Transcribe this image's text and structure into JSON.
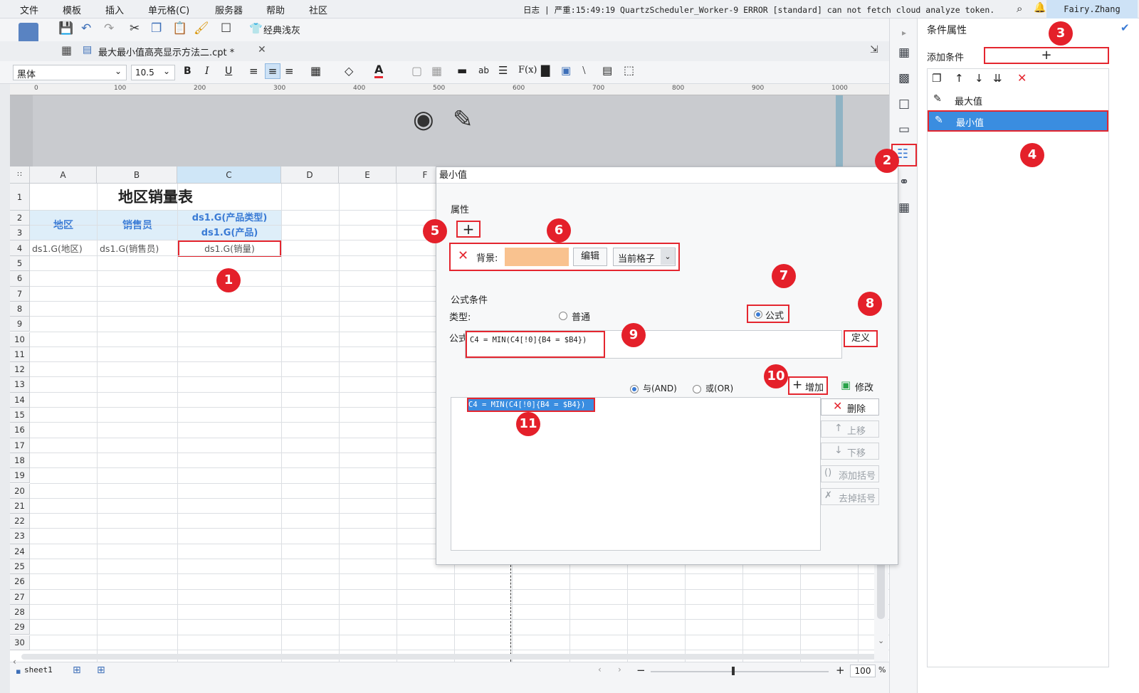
{
  "menu": {
    "items": [
      "文件",
      "模板",
      "插入",
      "单元格(C)",
      "服务器",
      "帮助",
      "社区"
    ]
  },
  "log": {
    "text": "日志 | 严重:15:49:19 QuartzScheduler_Worker-9 ERROR [standard] can not fetch cloud analyze token."
  },
  "user": {
    "name": "Fairy.Zhang"
  },
  "toolbar": {
    "theme_label": "经典浅灰"
  },
  "tab": {
    "title": "最大最小值高亮显示方法二.cpt *"
  },
  "format": {
    "font_family": "黑体",
    "font_size": "10.5"
  },
  "ruler": {
    "ticks": [
      "0",
      "100",
      "200",
      "300",
      "400",
      "500",
      "600",
      "700",
      "800",
      "900",
      "1000"
    ]
  },
  "sheet": {
    "columns": [
      "A",
      "B",
      "C",
      "D",
      "E",
      "F"
    ],
    "rows": [
      "1",
      "2",
      "3",
      "4",
      "5",
      "6",
      "7",
      "8",
      "9",
      "10",
      "11",
      "12",
      "13",
      "14",
      "15",
      "16",
      "17",
      "18",
      "19",
      "20",
      "21",
      "22",
      "23",
      "24",
      "25",
      "26",
      "27",
      "28",
      "29",
      "30"
    ],
    "title": "地区销量表",
    "header_region": "地区",
    "header_seller": "销售员",
    "header_type": "ds1.G(产品类型)",
    "header_product": "ds1.G(产品)",
    "cell_a4": "ds1.G(地区)",
    "cell_b4": "ds1.G(销售员)",
    "cell_c4": "ds1.G(销量)",
    "sheet_tab": "sheet1"
  },
  "zoom": {
    "value": "100",
    "unit": "%"
  },
  "dialog": {
    "title": "最小值",
    "section_attr": "属性",
    "attr_label": "背景:",
    "attr_color": "#f9c28f",
    "edit_button": "编辑",
    "scope_select": "当前格子",
    "section_formula": "公式条件",
    "type_label": "类型:",
    "radio_normal": "普通",
    "radio_formula": "公式",
    "formula_label": "公式=",
    "formula_value": "C4 = MIN(C4[!0]{B4 = $B4})",
    "define_button": "定义",
    "and_label": "与(AND)",
    "or_label": "或(OR)",
    "add_button": "增加",
    "modify_button": "修改",
    "delete_button": "删除",
    "up_button": "上移",
    "down_button": "下移",
    "add_paren_button": "添加括号",
    "remove_paren_button": "去掉括号",
    "condition_item": "C4 = MIN(C4[!0]{B4 = $B4})"
  },
  "panel": {
    "title": "条件属性",
    "add_condition_label": "添加条件",
    "conditions": [
      "最大值",
      "最小值"
    ]
  },
  "markers": [
    "1",
    "2",
    "3",
    "4",
    "5",
    "6",
    "7",
    "8",
    "9",
    "10",
    "11"
  ],
  "colors": {
    "accent": "#3a7bd5",
    "marker": "#e4202a",
    "selection": "#3a8de0"
  }
}
